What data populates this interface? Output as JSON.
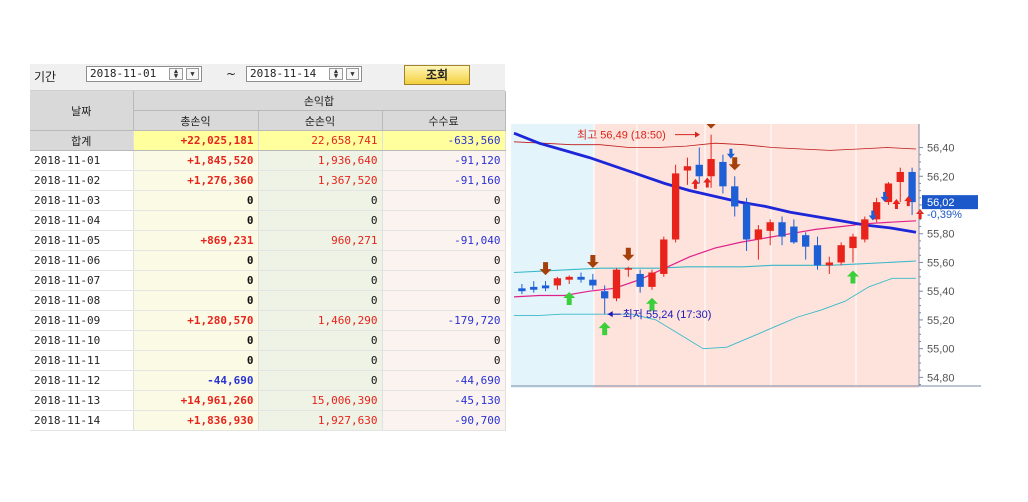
{
  "filter": {
    "period_label": "기간",
    "start_date": "2018-11-01",
    "end_date": "2018-11-14",
    "tilde": "~",
    "query_button": "조회"
  },
  "table": {
    "header_date": "날짜",
    "header_group": "손익합",
    "columns": [
      "총손익",
      "순손익",
      "수수료"
    ],
    "total": {
      "label": "합계",
      "gross": "+22,025,181",
      "net": "22,658,741",
      "fee": "-633,560"
    },
    "rows": [
      {
        "date": "2018-11-01",
        "gross": "+1,845,520",
        "net": "1,936,640",
        "fee": "-91,120"
      },
      {
        "date": "2018-11-02",
        "gross": "+1,276,360",
        "net": "1,367,520",
        "fee": "-91,160"
      },
      {
        "date": "2018-11-03",
        "gross": "0",
        "net": "0",
        "fee": "0"
      },
      {
        "date": "2018-11-04",
        "gross": "0",
        "net": "0",
        "fee": "0"
      },
      {
        "date": "2018-11-05",
        "gross": "+869,231",
        "net": "960,271",
        "fee": "-91,040"
      },
      {
        "date": "2018-11-06",
        "gross": "0",
        "net": "0",
        "fee": "0"
      },
      {
        "date": "2018-11-07",
        "gross": "0",
        "net": "0",
        "fee": "0"
      },
      {
        "date": "2018-11-08",
        "gross": "0",
        "net": "0",
        "fee": "0"
      },
      {
        "date": "2018-11-09",
        "gross": "+1,280,570",
        "net": "1,460,290",
        "fee": "-179,720"
      },
      {
        "date": "2018-11-10",
        "gross": "0",
        "net": "0",
        "fee": "0"
      },
      {
        "date": "2018-11-11",
        "gross": "0",
        "net": "0",
        "fee": "0"
      },
      {
        "date": "2018-11-12",
        "gross": "-44,690",
        "net": "0",
        "fee": "-44,690"
      },
      {
        "date": "2018-11-13",
        "gross": "+14,961,260",
        "net": "15,006,390",
        "fee": "-45,130"
      },
      {
        "date": "2018-11-14",
        "gross": "+1,836,930",
        "net": "1,927,630",
        "fee": "-90,700"
      }
    ]
  },
  "colors": {
    "positive": "#e8231b",
    "negative": "#2a32d4",
    "bull_candle": "#e8231b",
    "bear_candle": "#1f5fd6",
    "ma_thick": "#1d26d8",
    "pink_line": "#e0218a",
    "teal_line": "#3ab8c8",
    "envelope": "#c01818",
    "shade_left": "#e3f5fb",
    "shade_right": "#fde3dc"
  },
  "chart_data": {
    "type": "candlestick",
    "ylim": [
      54.74,
      56.55
    ],
    "yticks": [
      "56,40",
      "56,20",
      "56,00",
      "55,80",
      "55,60",
      "55,40",
      "55,20",
      "55,00",
      "54,80"
    ],
    "current_price_label": "56,02",
    "change_label": "-0,39%",
    "high_annotation": "최고 56,49 (18:50)",
    "low_annotation": "최저 55,24 (17:30)",
    "candles": [
      {
        "o": 55.42,
        "h": 55.45,
        "l": 55.38,
        "c": 55.4
      },
      {
        "o": 55.43,
        "h": 55.47,
        "l": 55.39,
        "c": 55.41
      },
      {
        "o": 55.44,
        "h": 55.47,
        "l": 55.4,
        "c": 55.42
      },
      {
        "o": 55.44,
        "h": 55.5,
        "l": 55.41,
        "c": 55.49
      },
      {
        "o": 55.48,
        "h": 55.51,
        "l": 55.45,
        "c": 55.5
      },
      {
        "o": 55.5,
        "h": 55.53,
        "l": 55.46,
        "c": 55.48
      },
      {
        "o": 55.48,
        "h": 55.52,
        "l": 55.41,
        "c": 55.44
      },
      {
        "o": 55.4,
        "h": 55.44,
        "l": 55.24,
        "c": 55.35
      },
      {
        "o": 55.35,
        "h": 55.56,
        "l": 55.33,
        "c": 55.55
      },
      {
        "o": 55.55,
        "h": 55.57,
        "l": 55.5,
        "c": 55.56
      },
      {
        "o": 55.52,
        "h": 55.55,
        "l": 55.39,
        "c": 55.43
      },
      {
        "o": 55.43,
        "h": 55.55,
        "l": 55.41,
        "c": 55.53
      },
      {
        "o": 55.52,
        "h": 55.78,
        "l": 55.5,
        "c": 55.76
      },
      {
        "o": 55.76,
        "h": 56.28,
        "l": 55.74,
        "c": 56.22
      },
      {
        "o": 56.24,
        "h": 56.33,
        "l": 56.14,
        "c": 56.27
      },
      {
        "o": 56.28,
        "h": 56.4,
        "l": 56.15,
        "c": 56.2
      },
      {
        "o": 56.2,
        "h": 56.49,
        "l": 56.12,
        "c": 56.32
      },
      {
        "o": 56.3,
        "h": 56.35,
        "l": 56.08,
        "c": 56.13
      },
      {
        "o": 56.13,
        "h": 56.2,
        "l": 55.92,
        "c": 55.99
      },
      {
        "o": 56.01,
        "h": 56.05,
        "l": 55.68,
        "c": 55.76
      },
      {
        "o": 55.76,
        "h": 55.86,
        "l": 55.62,
        "c": 55.83
      },
      {
        "o": 55.82,
        "h": 55.9,
        "l": 55.72,
        "c": 55.88
      },
      {
        "o": 55.88,
        "h": 55.92,
        "l": 55.72,
        "c": 55.78
      },
      {
        "o": 55.85,
        "h": 55.9,
        "l": 55.73,
        "c": 55.74
      },
      {
        "o": 55.79,
        "h": 55.81,
        "l": 55.62,
        "c": 55.71
      },
      {
        "o": 55.72,
        "h": 55.78,
        "l": 55.55,
        "c": 55.58
      },
      {
        "o": 55.58,
        "h": 55.64,
        "l": 55.52,
        "c": 55.6
      },
      {
        "o": 55.6,
        "h": 55.74,
        "l": 55.58,
        "c": 55.72
      },
      {
        "o": 55.7,
        "h": 55.8,
        "l": 55.6,
        "c": 55.78
      },
      {
        "o": 55.76,
        "h": 55.92,
        "l": 55.74,
        "c": 55.9
      },
      {
        "o": 55.9,
        "h": 56.05,
        "l": 55.88,
        "c": 56.02
      },
      {
        "o": 56.02,
        "h": 56.16,
        "l": 56.0,
        "c": 56.15
      },
      {
        "o": 56.16,
        "h": 56.26,
        "l": 56.02,
        "c": 56.23
      },
      {
        "o": 56.23,
        "h": 56.26,
        "l": 55.93,
        "c": 56.02
      }
    ],
    "ma_thick": [
      56.5,
      56.43,
      56.38,
      56.33,
      56.27,
      56.21,
      56.15,
      56.1,
      56.06,
      56.02,
      55.99,
      55.95,
      55.92,
      55.89,
      55.86,
      55.84,
      55.81
    ],
    "pink_line": [
      55.36,
      55.37,
      55.37,
      55.4,
      55.42,
      55.48,
      55.56,
      55.64,
      55.7,
      55.74,
      55.77,
      55.8,
      55.83,
      55.85,
      55.87,
      55.88,
      55.89
    ],
    "teal_line": [
      55.53,
      55.54,
      55.55,
      55.56,
      55.56,
      55.56,
      55.57,
      55.57,
      55.57,
      55.58,
      55.58,
      55.58,
      55.59,
      55.6,
      55.61
    ],
    "upper_band": [
      56.44,
      56.43,
      56.42,
      56.42,
      56.4,
      56.4,
      56.41,
      56.43,
      56.42,
      56.4,
      56.39,
      56.38,
      56.39,
      56.4,
      56.39
    ],
    "lower_band": [
      55.23,
      55.23,
      55.24,
      55.24,
      55.24,
      55.24,
      55.2,
      55.1,
      55.0,
      55.01,
      55.08,
      55.15,
      55.22,
      55.27,
      55.33,
      55.43,
      55.49,
      55.49
    ],
    "sell_arrow_candles": [
      2,
      6,
      9,
      16,
      18
    ],
    "buy_arrow_candles": [
      4,
      7,
      11,
      28
    ],
    "mini_buy_candles": [
      14,
      15,
      31,
      32,
      33
    ],
    "mini_sell_candles": [
      17,
      29,
      30
    ]
  }
}
